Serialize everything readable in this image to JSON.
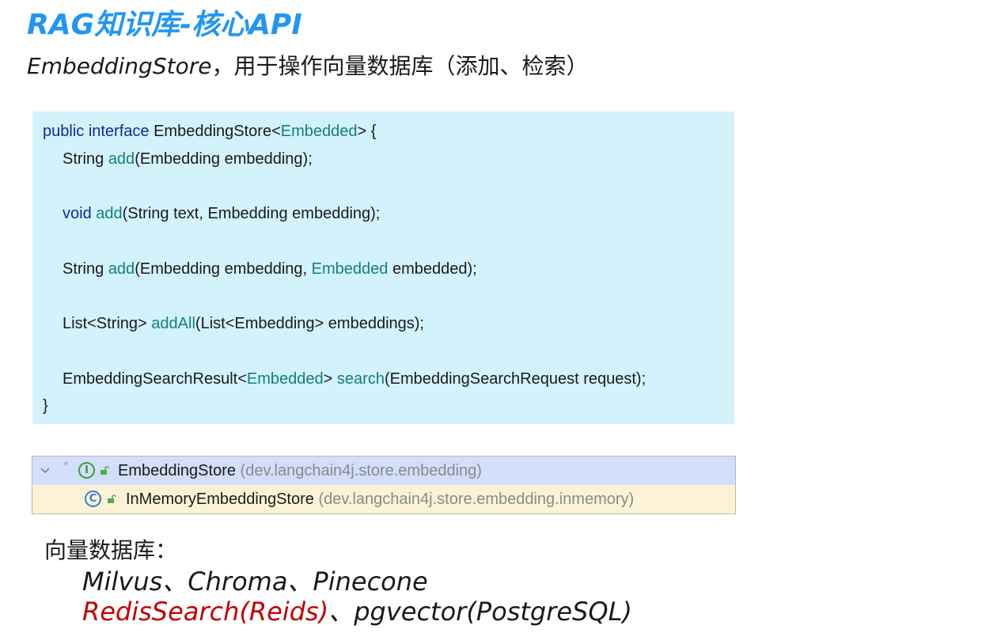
{
  "title": "RAG知识库-核心API",
  "subtitle": {
    "class_name": "EmbeddingStore",
    "description": "，用于操作向量数据库（添加、检索）"
  },
  "code": {
    "line1": {
      "p1": "public interface ",
      "p2": "EmbeddingStore<",
      "p3": "Embedded",
      "p4": "> {"
    },
    "line2": {
      "p1": "String ",
      "p2": "add",
      "p3": "(Embedding embedding);"
    },
    "line3": {
      "p1": "void ",
      "p2": "add",
      "p3": "(String text, Embedding embedding);"
    },
    "line4": {
      "p1": "String ",
      "p2": "add",
      "p3": "(Embedding embedding, ",
      "p4": "Embedded",
      "p5": " embedded);"
    },
    "line5": {
      "p1": "List<String> ",
      "p2": "addAll",
      "p3": "(List<Embedding> embeddings);"
    },
    "line6": {
      "p1": "EmbeddingSearchResult<",
      "p2": "Embedded",
      "p3": "> ",
      "p4": "search",
      "p5": "(EmbeddingSearchRequest request);"
    },
    "line7": "}"
  },
  "tree": {
    "rows": [
      {
        "name": "EmbeddingStore",
        "package": "(dev.langchain4j.store.embedding)",
        "icon": "interface-icon"
      },
      {
        "name": "InMemoryEmbeddingStore",
        "package": "(dev.langchain4j.store.embedding.inmemory)",
        "icon": "class-icon"
      }
    ]
  },
  "notes": {
    "title": "向量数据库：",
    "line1": "Milvus、Chroma、Pinecone",
    "line2_red": "RedisSearch(Reids)",
    "line2_rest": "、pgvector(PostgreSQL)"
  },
  "colors": {
    "title": "#2196f3",
    "code_bg": "#d4f2fb",
    "keyword": "#0d2a9c",
    "type_param": "#13807a",
    "highlight_red": "#c00000"
  }
}
